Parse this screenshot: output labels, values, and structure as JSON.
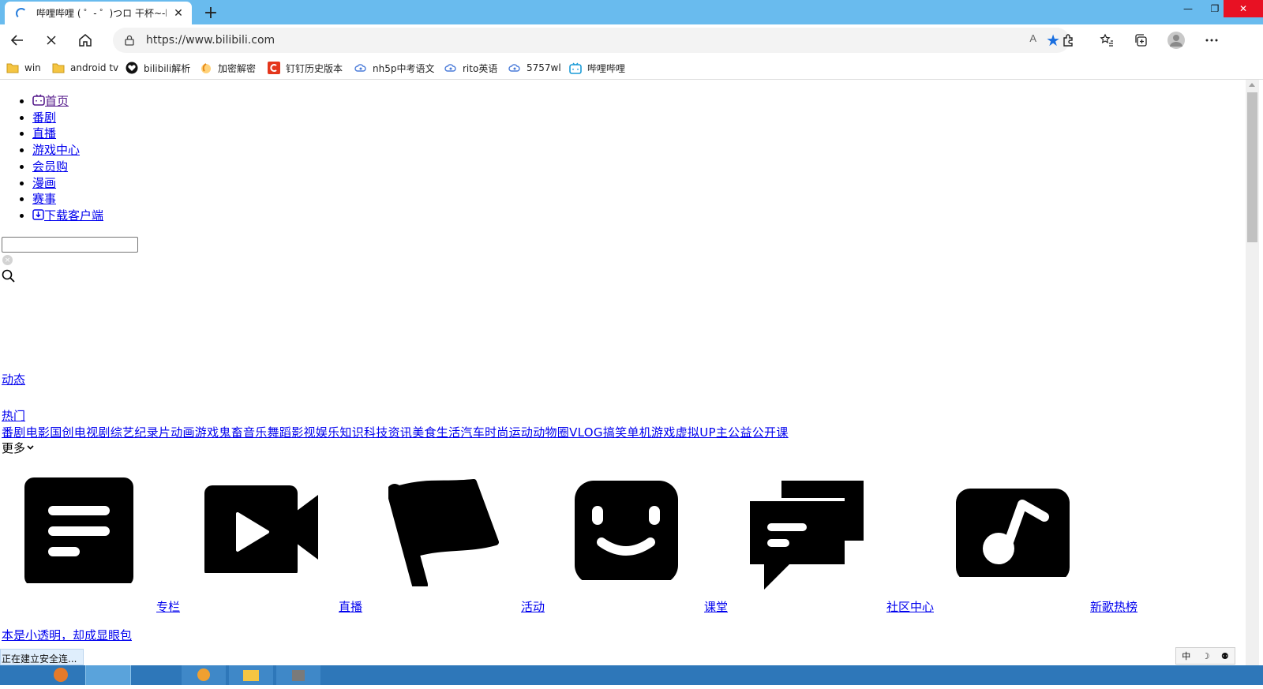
{
  "browser": {
    "tab_title": "哔哩哔哩 ( ゜- ゜)つロ 干杯~-bili",
    "tab_close": "✕",
    "new_tab": "+",
    "window_controls": {
      "minimize": "—",
      "maximize": "❐",
      "close": "✕"
    },
    "url": "https://www.bilibili.com",
    "read_aloud": "A",
    "favorite_star": "★"
  },
  "bookmarks": [
    {
      "label": "win",
      "icon": "folder-icon"
    },
    {
      "label": "android tv",
      "icon": "folder-icon"
    },
    {
      "label": "bilibili解析",
      "icon": "heart-icon"
    },
    {
      "label": "加密解密",
      "icon": "swirl-icon"
    },
    {
      "label": "钉钉历史版本",
      "icon": "c-logo-icon"
    },
    {
      "label": "nh5p中考语文",
      "icon": "cloud-icon"
    },
    {
      "label": "rito英语",
      "icon": "cloud-icon"
    },
    {
      "label": "5757wl",
      "icon": "cloud-icon"
    },
    {
      "label": "哔哩哔哩",
      "icon": "bilibili-tv-icon"
    }
  ],
  "nav": {
    "items": [
      {
        "label": "首页",
        "icon": "bilibili-tv-icon"
      },
      {
        "label": "番剧"
      },
      {
        "label": "直播"
      },
      {
        "label": "游戏中心"
      },
      {
        "label": "会员购"
      },
      {
        "label": "漫画"
      },
      {
        "label": "赛事"
      },
      {
        "label": "下载客户端",
        "icon": "download-icon"
      }
    ]
  },
  "search": {
    "value": "",
    "clear": "×"
  },
  "dynamic_label": "动态",
  "hot_label": "热门",
  "categories": "番剧电影国创电视剧综艺纪录片动画游戏鬼畜音乐舞蹈影视娱乐知识科技资讯美食生活汽车时尚运动动物圈VLOG搞笑单机游戏虚拟UP主公益公开课",
  "more_label": "更多",
  "more_chevron": "⌄",
  "feature_links": [
    {
      "label": "专栏",
      "icon": "article-icon"
    },
    {
      "label": "直播",
      "icon": "video-camera-icon"
    },
    {
      "label": "活动",
      "icon": "flag-icon"
    },
    {
      "label": "课堂",
      "icon": "smile-face-icon"
    },
    {
      "label": "社区中心",
      "icon": "chat-bubbles-icon"
    },
    {
      "label": "新歌热榜",
      "icon": "music-note-icon"
    }
  ],
  "bottom_link": "本是小透明，却成显眼包",
  "status_text": "正在建立安全连...",
  "ime": {
    "mode": "中",
    "moon": "☽",
    "person": "⚉"
  },
  "colors": {
    "titlebar": "#69bbee",
    "taskbar": "#2e77b9",
    "link": "#0000ee",
    "visited": "#551a8b",
    "close": "#e81123"
  }
}
